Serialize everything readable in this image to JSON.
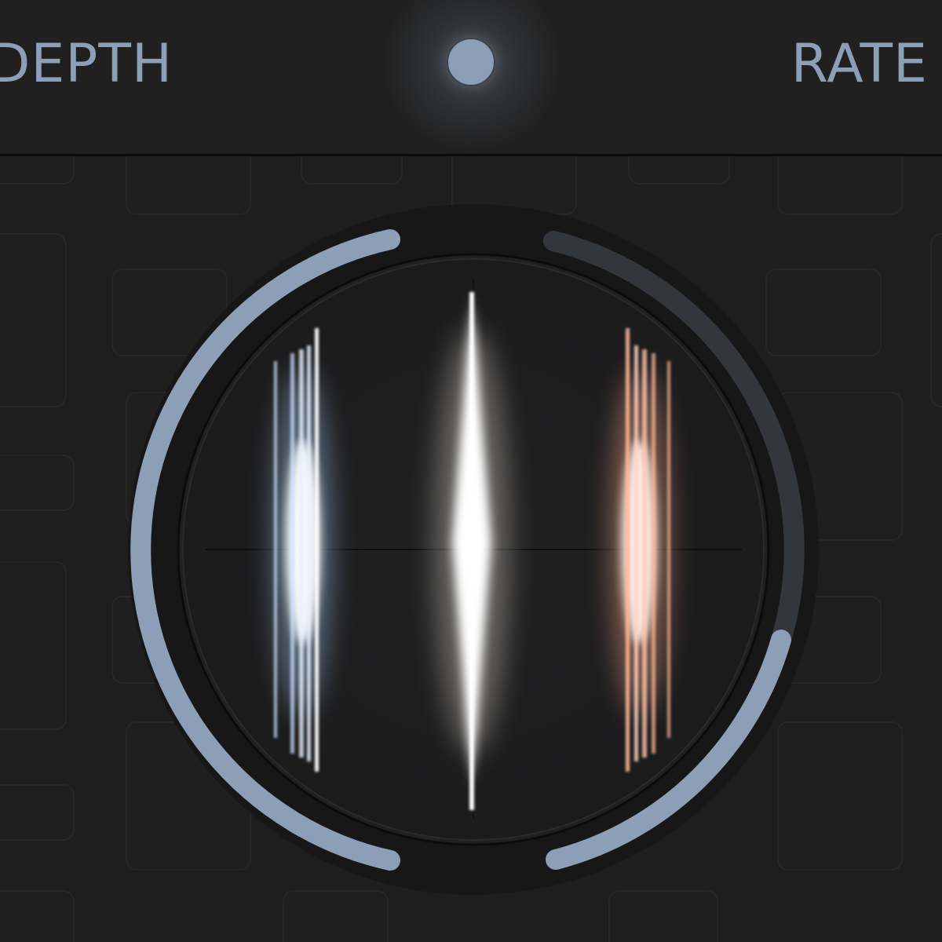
{
  "header": {
    "left_label": "DEPTH",
    "right_label": "RATE"
  },
  "knob": {
    "accent_color": "#8d9fb6",
    "track_color": "#33373c",
    "left_value": 0.5,
    "right_value": 0.3
  },
  "visualizer": {
    "left_color": "#cfe4ff",
    "center_color": "#ffffff",
    "right_color": "#ffb79a"
  }
}
